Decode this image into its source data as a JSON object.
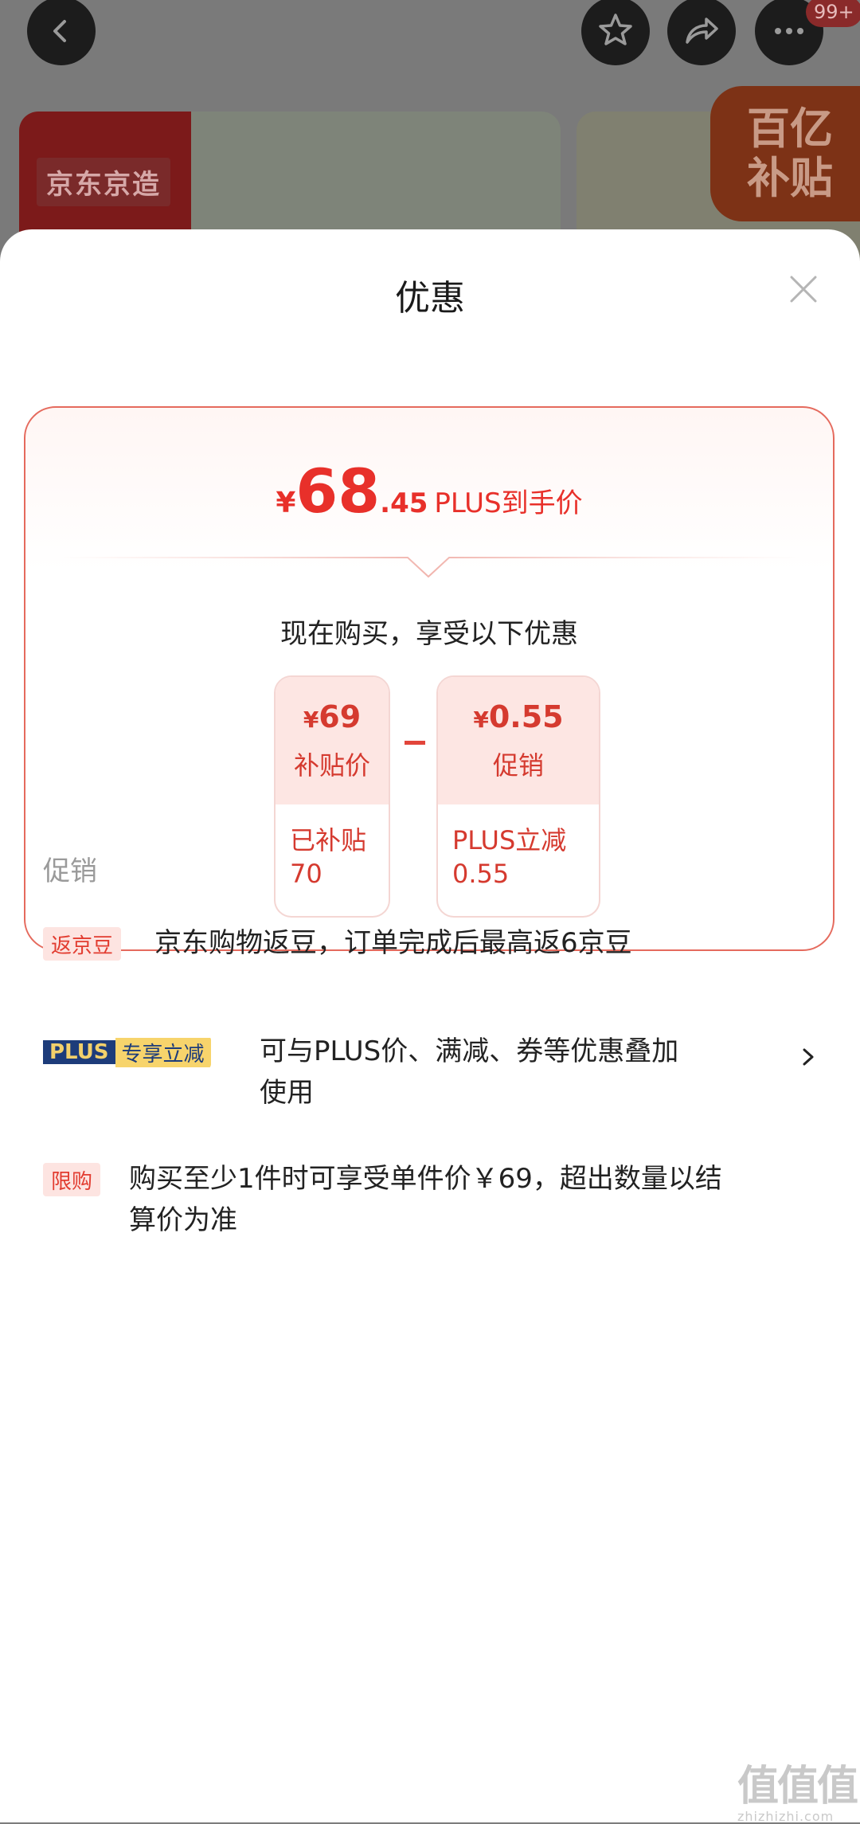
{
  "background": {
    "badge_count": "99+",
    "brand_label": "京东京造",
    "subsidy_line1": "百亿",
    "subsidy_line2": "补贴"
  },
  "sheet": {
    "title": "优惠",
    "price": {
      "currency": "¥",
      "integer": "68",
      "decimal": ".45",
      "label": "PLUS到手价"
    },
    "subtitle": "现在购买，享受以下优惠",
    "chips": [
      {
        "currency": "¥",
        "amount": "69",
        "caption": "补贴价",
        "detail_line1": "已补贴",
        "detail_line2": "70"
      },
      {
        "currency": "¥",
        "amount": "0.55",
        "caption": "促销",
        "detail_line1": "PLUS立减",
        "detail_line2": "0.55"
      }
    ]
  },
  "promotions": {
    "title": "促销",
    "items": [
      {
        "tag": "返京豆",
        "text": "京东购物返豆，订单完成后最高返6京豆"
      },
      {
        "tag_plus": "PLUS",
        "tag_sub": "专享立减",
        "text_line1": "可与PLUS价、满减、券等优惠叠加",
        "text_line2": "使用"
      },
      {
        "tag": "限购",
        "text_line1": "购买至少1件时可享受单件价￥69，超出数量以结",
        "text_line2": "算价为准"
      }
    ]
  },
  "watermark": {
    "glyphs": "值值值",
    "url": "zhizhizhi.com"
  },
  "colors": {
    "accent_red": "#e8302a",
    "plus_blue": "#1d3c7a",
    "plus_gold": "#f7d46c"
  },
  "icons": [
    "back-icon",
    "star-icon",
    "share-icon",
    "more-icon",
    "close-icon",
    "chevron-right-icon"
  ]
}
